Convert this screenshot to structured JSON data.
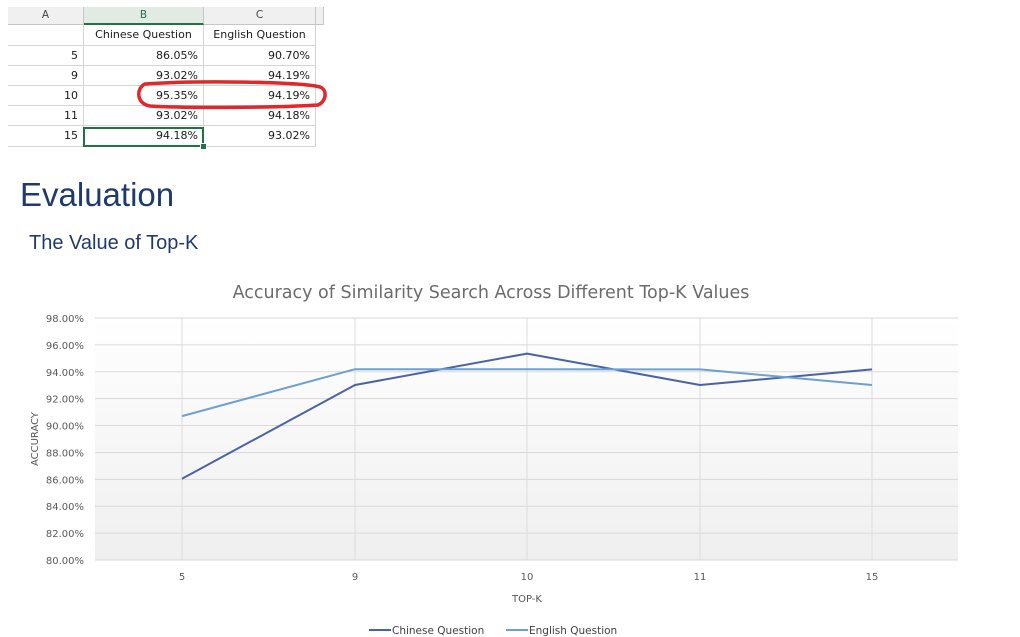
{
  "sheet": {
    "column_headers": [
      "A",
      "B",
      "C"
    ],
    "header_row": {
      "b": "Chinese Question",
      "c": "English Question"
    },
    "rows": [
      {
        "row": "5",
        "b": "86.05%",
        "c": "90.70%"
      },
      {
        "row": "9",
        "b": "93.02%",
        "c": "94.19%"
      },
      {
        "row": "10",
        "b": "95.35%",
        "c": "94.19%"
      },
      {
        "row": "11",
        "b": "93.02%",
        "c": "94.18%"
      },
      {
        "row": "15",
        "b": "94.18%",
        "c": "93.02%"
      }
    ],
    "selected_column": "B",
    "highlight_color": "#e3262a",
    "selection_color": "#217346"
  },
  "section_title": "Evaluation",
  "subsection_title": "The Value of Top-K",
  "chart_data": {
    "type": "line",
    "title": "Accuracy of Similarity Search Across Different Top-K Values",
    "xlabel": "TOP-K",
    "ylabel": "ACCURACY",
    "categories": [
      "5",
      "9",
      "10",
      "11",
      "15"
    ],
    "series": [
      {
        "name": "Chinese Question",
        "values": [
          86.05,
          93.02,
          95.35,
          93.02,
          94.18
        ],
        "color": "#4a63a6"
      },
      {
        "name": "English Question",
        "values": [
          90.7,
          94.19,
          94.19,
          94.18,
          93.02
        ],
        "color": "#6ea0d0"
      }
    ],
    "ylim": [
      80,
      98
    ],
    "yticks": [
      "80.00%",
      "82.00%",
      "84.00%",
      "86.00%",
      "88.00%",
      "90.00%",
      "92.00%",
      "94.00%",
      "96.00%",
      "98.00%"
    ],
    "grid": true,
    "legend": "bottom"
  }
}
